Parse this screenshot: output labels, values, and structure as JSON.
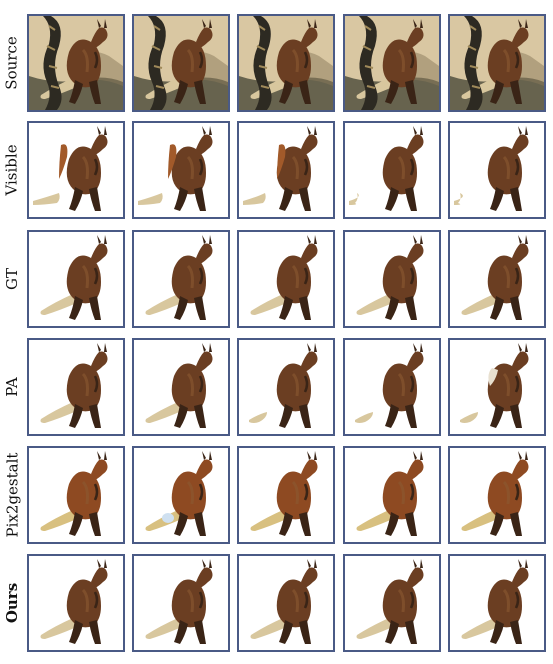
{
  "rows": [
    {
      "label": "Source",
      "bold": false,
      "kind": "source"
    },
    {
      "label": "Visible",
      "bold": false,
      "kind": "visible"
    },
    {
      "label": "GT",
      "bold": false,
      "kind": "gt"
    },
    {
      "label": "PA",
      "bold": false,
      "kind": "pa"
    },
    {
      "label": "Pix2gestalt",
      "bold": false,
      "kind": "pix2gestalt"
    },
    {
      "label": "Ours",
      "bold": true,
      "kind": "ours"
    }
  ],
  "columns": 5,
  "colors": {
    "frame_border": "#4a5a86",
    "kangaroo_body": "#6b3e22",
    "kangaroo_dark": "#3a2416",
    "kangaroo_light": "#d8c79e",
    "pix2gestalt_body": "#8e4a22",
    "sand": "#d9c7a2",
    "shadow": "#4a4a3a",
    "snake": "#2d2a22"
  }
}
